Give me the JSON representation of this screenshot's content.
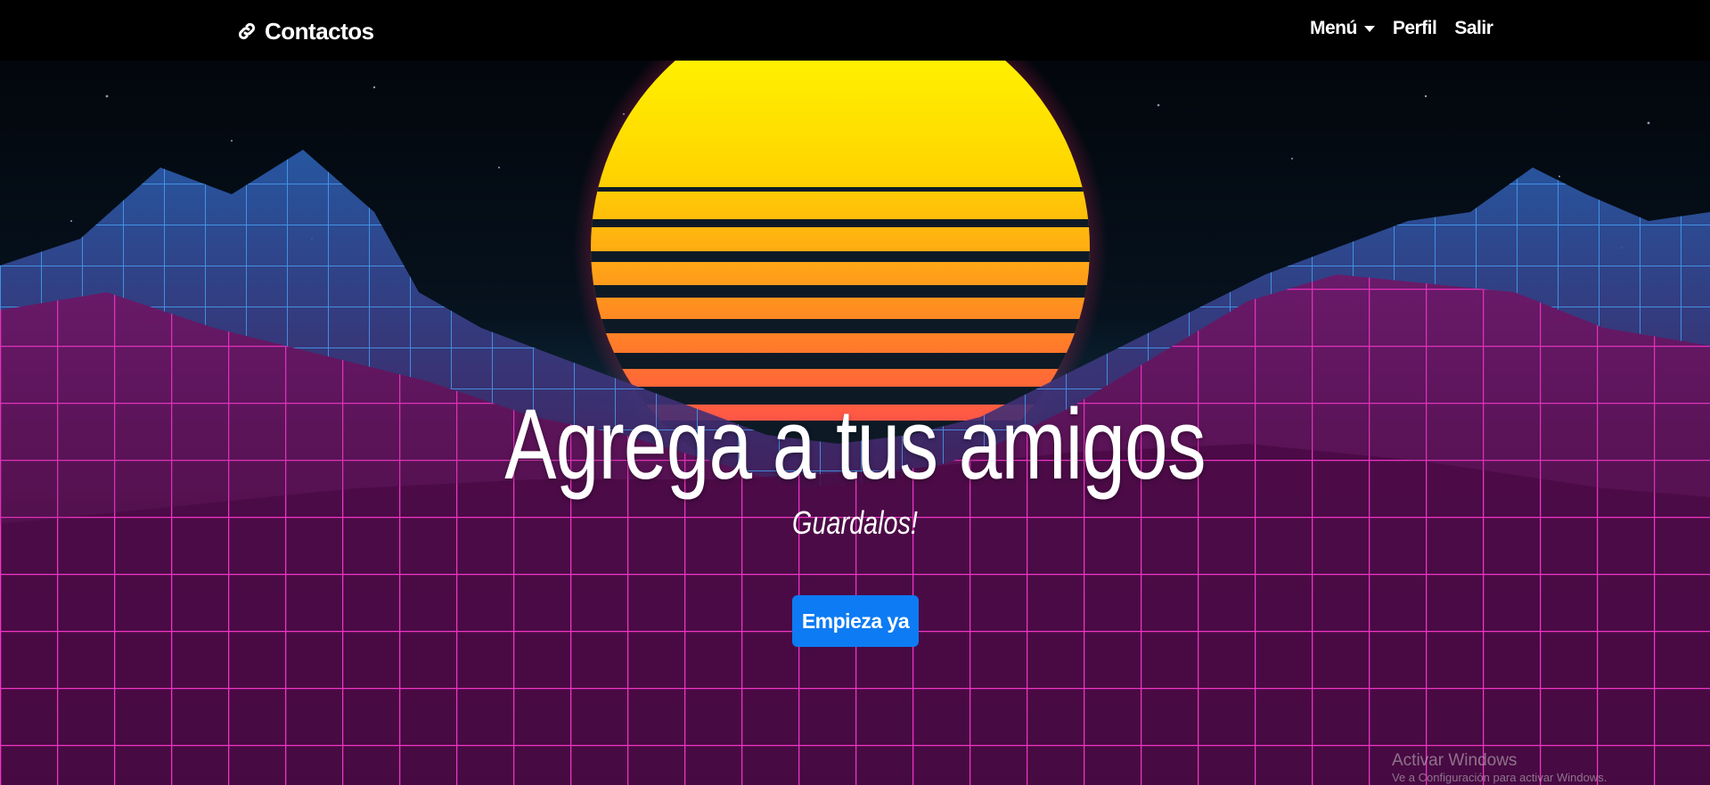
{
  "navbar": {
    "brand": {
      "icon": "link-icon",
      "label": "Contactos"
    },
    "menu": {
      "label": "Menú",
      "icon": "caret-down-icon"
    },
    "profile": "Perfil",
    "logout": "Salir"
  },
  "hero": {
    "title": "Agrega a tus amigos",
    "subtitle": "Guardalos!",
    "cta": "Empieza ya"
  },
  "os_watermark": {
    "title": "Activar Windows",
    "subtitle": "Ve a Configuración para activar Windows."
  },
  "colors": {
    "accent": "#0d7bf3",
    "navbar": "#000000",
    "sun_top": "#ffff00",
    "sun_bottom": "#ff3a5c",
    "grid": "#ff33c8",
    "mountains": "#3a8cff"
  }
}
